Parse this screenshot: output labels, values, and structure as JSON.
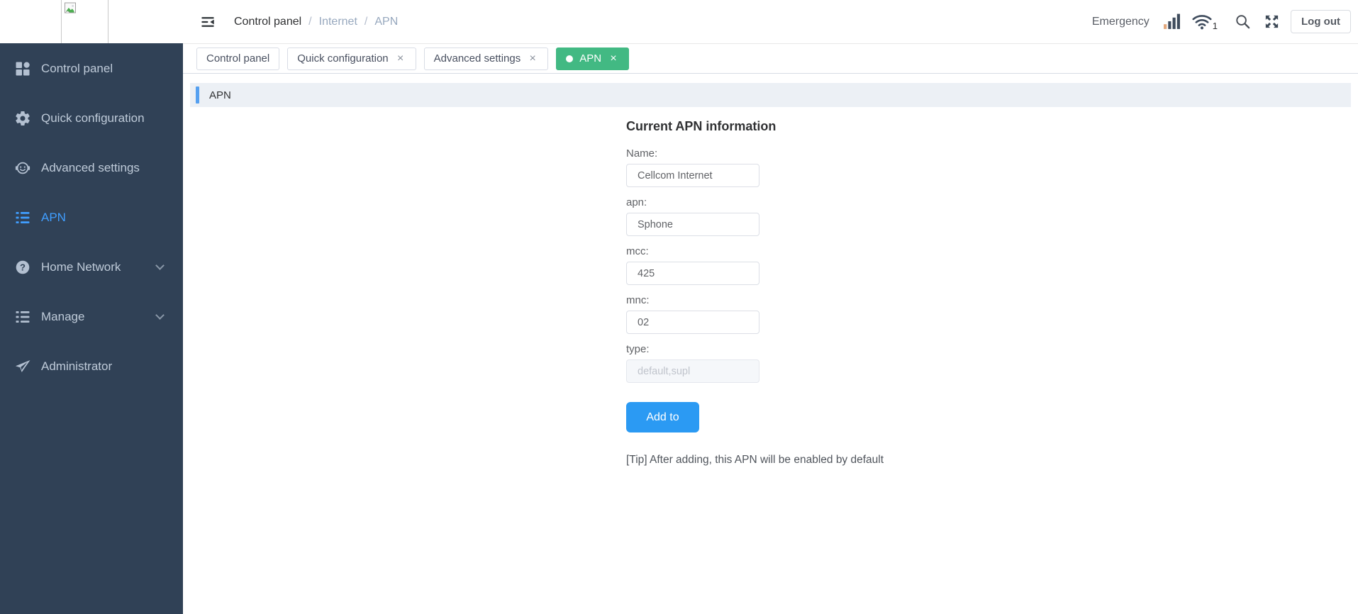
{
  "colors": {
    "sidebar_bg": "#304156",
    "sidebar_text": "#bfcbd9",
    "sidebar_active_blue": "#409eff",
    "active_tab_green": "#42b983",
    "panel_header_bg": "#ecf0f5",
    "panel_accent_blue": "#55a0f0",
    "primary_button_blue": "#2b9af3",
    "signal_bar_orange": "#e3a87c",
    "header_icon_dark": "#3e4b5c"
  },
  "glyphs": {
    "close": "×",
    "breadcrumb_separator": "/"
  },
  "sidebar": {
    "items": [
      {
        "label": "Control panel",
        "icon": "grid-icon",
        "active": false,
        "expandable": false
      },
      {
        "label": "Quick configuration",
        "icon": "gear-icon",
        "active": false,
        "expandable": false
      },
      {
        "label": "Advanced settings",
        "icon": "support-face-icon",
        "active": false,
        "expandable": false
      },
      {
        "label": "APN",
        "icon": "list-icon",
        "active": true,
        "expandable": false
      },
      {
        "label": "Home Network",
        "icon": "help-circle-icon",
        "active": false,
        "expandable": true
      },
      {
        "label": "Manage",
        "icon": "list-icon",
        "active": false,
        "expandable": true
      },
      {
        "label": "Administrator",
        "icon": "paper-plane-icon",
        "active": false,
        "expandable": false
      }
    ]
  },
  "header": {
    "breadcrumb": [
      "Control panel",
      "Internet",
      "APN"
    ],
    "emergency_label": "Emergency",
    "wifi_count": "1",
    "logout_label": "Log out"
  },
  "tabs": [
    {
      "label": "Control panel",
      "closable": false,
      "active": false
    },
    {
      "label": "Quick configuration",
      "closable": true,
      "active": false
    },
    {
      "label": "Advanced settings",
      "closable": true,
      "active": false
    },
    {
      "label": "APN",
      "closable": true,
      "active": true
    }
  ],
  "panel": {
    "title": "APN"
  },
  "form": {
    "title": "Current APN information",
    "fields": [
      {
        "label": "Name:",
        "value": "Cellcom Internet",
        "placeholder": "",
        "disabled": false
      },
      {
        "label": "apn:",
        "value": "Sphone",
        "placeholder": "",
        "disabled": false
      },
      {
        "label": "mcc:",
        "value": "425",
        "placeholder": "",
        "disabled": false
      },
      {
        "label": "mnc:",
        "value": "02",
        "placeholder": "",
        "disabled": false
      },
      {
        "label": "type:",
        "value": "",
        "placeholder": "default,supl",
        "disabled": true
      }
    ],
    "submit_label": "Add to",
    "tip": "[Tip] After adding, this APN will be enabled by default"
  }
}
